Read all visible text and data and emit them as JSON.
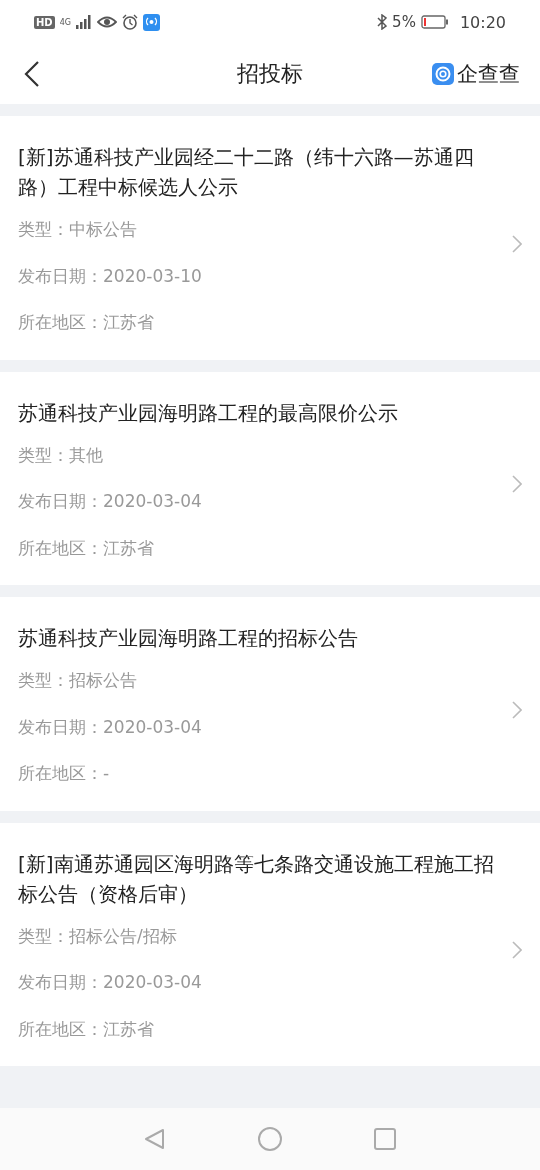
{
  "status_bar": {
    "hd": "HD",
    "network": "4G",
    "battery": "5%",
    "time": "10:20"
  },
  "header": {
    "title": "招投标",
    "brand": "企查查"
  },
  "items": [
    {
      "title": "[新]苏通科技产业园经二十二路（纬十六路—苏通四路）工程中标候选人公示",
      "fields": [
        "类型：中标公告",
        "发布日期：2020-03-10",
        "所在地区：江苏省"
      ]
    },
    {
      "title": "苏通科技产业园海明路工程的最高限价公示",
      "fields": [
        "类型：其他",
        "发布日期：2020-03-04",
        "所在地区：江苏省"
      ]
    },
    {
      "title": "苏通科技产业园海明路工程的招标公告",
      "fields": [
        "类型：招标公告",
        "发布日期：2020-03-04",
        "所在地区：-"
      ]
    },
    {
      "title": "[新]南通苏通园区海明路等七条路交通设施工程施工招标公告（资格后审）",
      "fields": [
        "类型：招标公告/招标",
        "发布日期：2020-03-04",
        "所在地区：江苏省"
      ]
    }
  ]
}
